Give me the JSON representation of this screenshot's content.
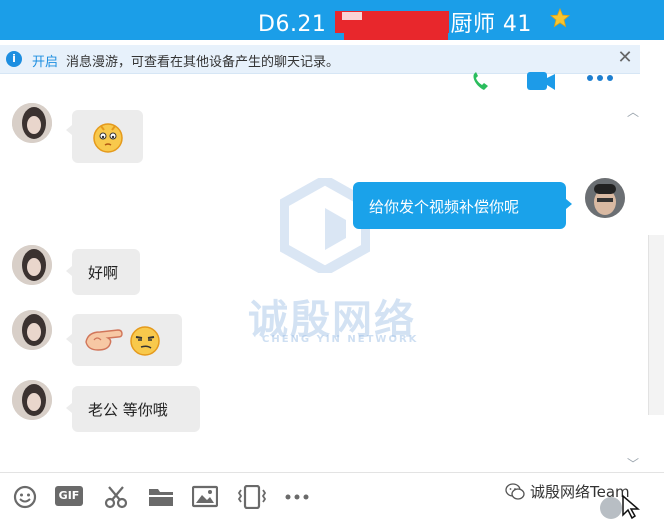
{
  "title": {
    "prefix": "D6.21",
    "suffix": "厨师 41"
  },
  "notice": {
    "link_text": "开启",
    "text": "消息漫游，可查看在其他设备产生的聊天记录。"
  },
  "messages": [
    {
      "side": "in",
      "text": "",
      "kind": "emoji"
    },
    {
      "side": "out",
      "text": "给你发个视频补偿你呢"
    },
    {
      "side": "in",
      "text": "好啊"
    },
    {
      "side": "in",
      "text": "",
      "kind": "emoji-pair"
    },
    {
      "side": "in",
      "text": "老公 等你哦"
    }
  ],
  "watermark": {
    "text": "诚殷网络",
    "sub": "CHENG YIN NETWORK"
  },
  "toolbar": {
    "gif_label": "GIF",
    "credit": "诚殷网络Team"
  },
  "colors": {
    "titlebar": "#1b9ee8",
    "bubble_out": "#1aa2ea",
    "bubble_in": "#ececec",
    "redaction": "#e8272c"
  }
}
